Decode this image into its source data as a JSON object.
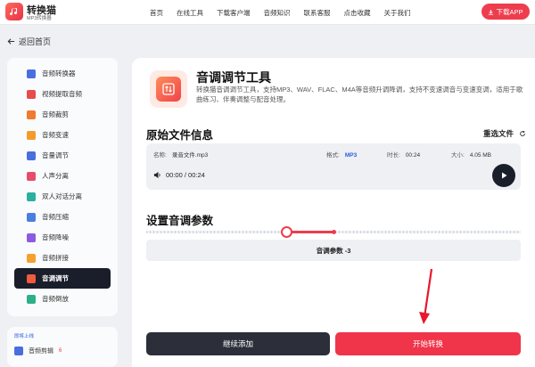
{
  "header": {
    "brand": "转换猫",
    "brand_sub": "MP3转换器",
    "nav": [
      "首页",
      "在线工具",
      "下载客户端",
      "音频知识",
      "联系客服",
      "点击收藏",
      "关于我们"
    ],
    "download_label": "下载APP"
  },
  "back_label": "返回首页",
  "sidebar": {
    "items": [
      {
        "label": "音频转换器",
        "color": "#4a6ee0"
      },
      {
        "label": "视频提取音频",
        "color": "#e84c4c"
      },
      {
        "label": "音频裁剪",
        "color": "#f07a2e"
      },
      {
        "label": "音频变速",
        "color": "#f59b2e"
      },
      {
        "label": "音量调节",
        "color": "#4a6ee0"
      },
      {
        "label": "人声分离",
        "color": "#e84c6c"
      },
      {
        "label": "双人对话分离",
        "color": "#2bb0a0"
      },
      {
        "label": "音频压缩",
        "color": "#4a7ee0"
      },
      {
        "label": "音频降噪",
        "color": "#8c5be0"
      },
      {
        "label": "音频拼接",
        "color": "#f5a12e"
      },
      {
        "label": "音调调节",
        "color": "#f05a3e",
        "active": true
      },
      {
        "label": "音频倒放",
        "color": "#2bb08a"
      }
    ],
    "extra_tag": "即将上线",
    "extra_item": "音频剪辑",
    "extra_badge": "6"
  },
  "tool": {
    "title": "音调调节工具",
    "description": "转换猫音调调节工具，支持MP3、WAV、FLAC、M4A等音频升调降调，支持不变速调音与变速变调，适用于歌曲练习、伴奏调整与配音处理。"
  },
  "file_info": {
    "section_title": "原始文件信息",
    "reselect_label": "重选文件",
    "name_label": "名称:",
    "name_value": "录音文件.mp3",
    "format_label": "格式:",
    "format_value": "MP3",
    "duration_label": "时长:",
    "duration_value": "00:24",
    "size_label": "大小:",
    "size_value": "4.05 MB",
    "playback": "00:00 / 00:24"
  },
  "params": {
    "section_title": "设置音调参数",
    "value_text": "音调参数 -3",
    "slider_level": 0.375
  },
  "actions": {
    "continue_label": "继续添加",
    "start_label": "开始转换"
  }
}
